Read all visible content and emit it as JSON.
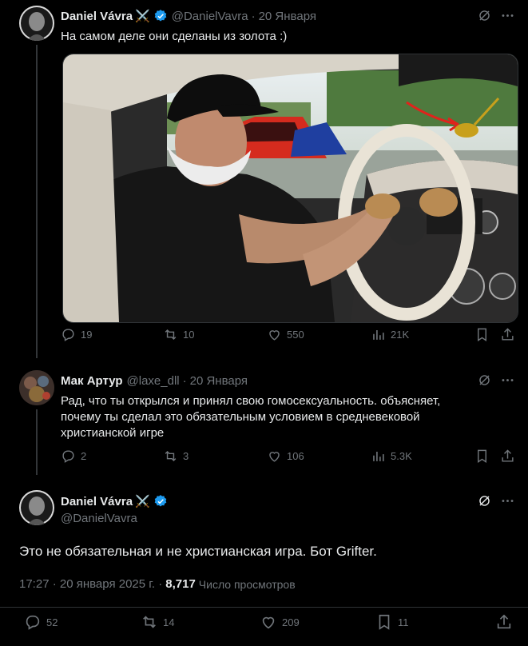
{
  "tweet1": {
    "name": "Daniel Vávra",
    "handle": "@DanielVavra",
    "date": "20 Января",
    "text": "На самом деле они сделаны из золота :)",
    "stats": {
      "replies": "19",
      "retweets": "10",
      "likes": "550",
      "views": "21K"
    }
  },
  "tweet2": {
    "name": "Мак Артур",
    "handle": "@laxe_dll",
    "date": "20 Января",
    "text_lines": [
      "Рад, что ты открылся и принял свою гомосексуальность.  объясняет,",
      "почему ты сделал это обязательным условием в средневековой",
      "христианской игре"
    ],
    "stats": {
      "replies": "2",
      "retweets": "3",
      "likes": "106",
      "views": "5.3K"
    }
  },
  "tweet3": {
    "name": "Daniel Vávra",
    "handle": "@DanielVavra",
    "text": "Это не обязательная и не христианская игра. Бот Grifter.",
    "time": "17:27 · 20 января 2025 г. ·",
    "views_count": "8,717",
    "views_label": "Число просмотров",
    "stats": {
      "replies": "52",
      "retweets": "14",
      "likes": "209",
      "bookmarks": "11"
    }
  },
  "colors": {
    "background": "#000000",
    "muted": "#71767b",
    "verified": "#1d9bf0",
    "text": "#e7e9ea"
  },
  "icons": [
    "grok-icon",
    "more-icon",
    "reply-icon",
    "retweet-icon",
    "like-icon",
    "views-icon",
    "bookmark-icon",
    "share-icon",
    "verified-icon",
    "swords-icon"
  ]
}
